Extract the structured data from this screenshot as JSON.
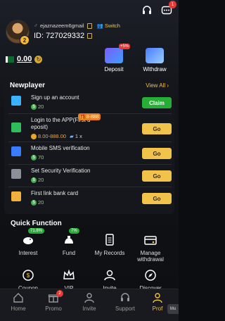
{
  "header": {
    "username": "ejaznazeem6gmail",
    "switch_label": "Switch",
    "id_label": "ID:",
    "user_id": "727029332",
    "level": "2",
    "balance": "0.00",
    "notification_count": "1"
  },
  "actions": {
    "deposit_label": "Deposit",
    "deposit_badge": "+5%",
    "withdraw_label": "Withdraw"
  },
  "newplayer": {
    "title": "Newplayer",
    "view_all": "View All",
    "tasks": [
      {
        "name": "Sign up an account",
        "reward": "20",
        "button": "Claim"
      },
      {
        "name_line1": "Login to the APP(First d",
        "name_line2": "eposit)",
        "reward": "8.00-888.00",
        "multiplier": "1 x",
        "gift": "8-888",
        "button": "Go"
      },
      {
        "name": "Mobile SMS verification",
        "reward": "70",
        "button": "Go"
      },
      {
        "name": "Set Security Verification",
        "reward": "20",
        "button": "Go"
      },
      {
        "name": "First link bank card",
        "reward": "20",
        "button": "Go"
      }
    ]
  },
  "quick_function": {
    "title": "Quick Function",
    "items": [
      {
        "label": "Interest",
        "badge": "71.8%"
      },
      {
        "label": "Fund",
        "badge": "7%"
      },
      {
        "label": "My Records"
      },
      {
        "label_line1": "Manage",
        "label_line2": "withdrawal"
      },
      {
        "label": "Coupon"
      },
      {
        "label": "VIP"
      },
      {
        "label": "Invite"
      },
      {
        "label": "Discover"
      }
    ]
  },
  "nav": {
    "items": [
      {
        "label": "Home"
      },
      {
        "label": "Promo",
        "badge": "2"
      },
      {
        "label": "Invite"
      },
      {
        "label": "Support"
      },
      {
        "label": "Prof"
      }
    ],
    "more": "Mu"
  },
  "colors": {
    "accent": "#f0c246",
    "claim": "#27ae37",
    "badge": "#e53935"
  }
}
